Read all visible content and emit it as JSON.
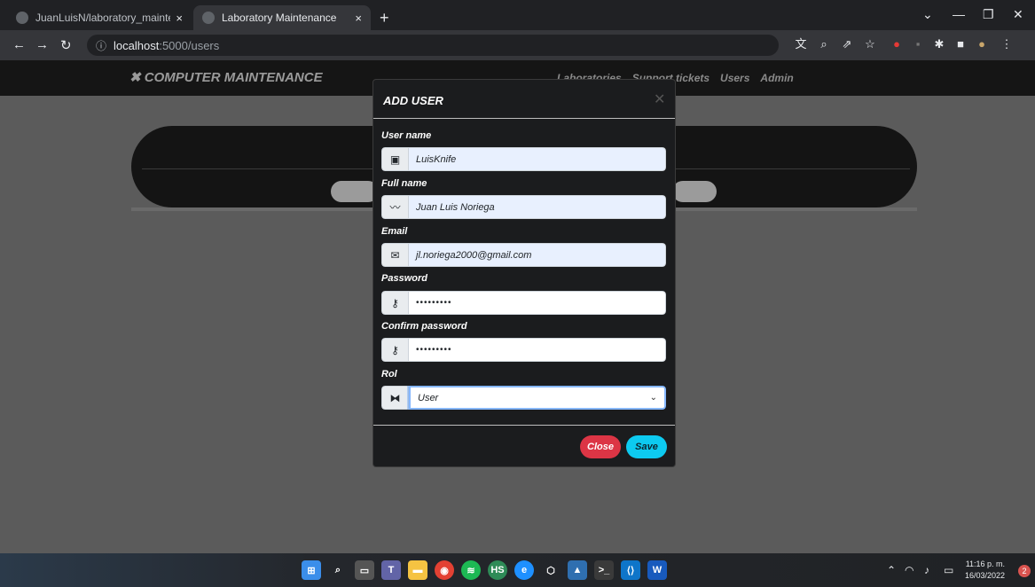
{
  "browser": {
    "tabs": [
      {
        "title": "JuanLuisN/laboratory_maintenan",
        "active": false
      },
      {
        "title": "Laboratory Maintenance",
        "active": true
      }
    ],
    "new_tab": "+",
    "url_host": "localhost",
    "url_path": ":5000/users"
  },
  "app": {
    "brand": "COMPUTER MAINTENANCE",
    "nav": [
      "Laboratories",
      "Support tickets",
      "Users",
      "Admin"
    ]
  },
  "modal": {
    "title": "ADD USER",
    "fields": [
      {
        "label": "User name",
        "value": "LuisKnife",
        "icon": "id-card-icon"
      },
      {
        "label": "Full name",
        "value": "Juan Luis Noriega",
        "icon": "signature-icon"
      },
      {
        "label": "Email",
        "value": "jl.noriega2000@gmail.com",
        "icon": "envelope-icon"
      },
      {
        "label": "Password",
        "value": "•••••••••",
        "icon": "key-icon"
      },
      {
        "label": "Confirm password",
        "value": "•••••••••",
        "icon": "key-icon"
      },
      {
        "label": "Rol",
        "value": "User",
        "icon": "sitemap-icon"
      }
    ],
    "close_label": "Close",
    "save_label": "Save"
  },
  "taskbar": {
    "time": "11:16 p. m.",
    "date": "16/03/2022",
    "notifications": "2"
  },
  "colors": {
    "close_button": "#dc3545",
    "save_button": "#0dcaf0",
    "modal_bg": "#1b1c1e"
  }
}
